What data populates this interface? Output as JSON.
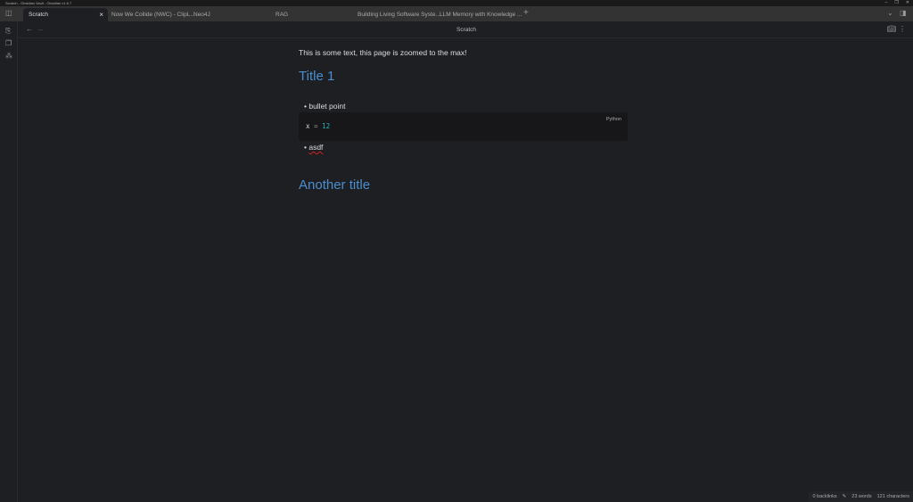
{
  "window": {
    "title": "Scratch - Obsidian Vault - Obsidian v1.6.7"
  },
  "tabs": [
    {
      "label": "Scratch",
      "active": true
    },
    {
      "label": "Now We Collide (NWC) - ClipL..."
    },
    {
      "label": "Neo4J"
    },
    {
      "label": "RAG"
    },
    {
      "label": "Building Living Software Syste..."
    },
    {
      "label": "LLM Memory with Knowledge ..."
    }
  ],
  "header": {
    "title": "Scratch"
  },
  "note": {
    "intro": "This is some text, this page is zoomed to the max!",
    "title1": "Title 1",
    "bullet1": "bullet point",
    "code": {
      "var": "x",
      "op": "=",
      "num": "12",
      "lang": "Python"
    },
    "bullet2": "asdf",
    "title2": "Another title"
  },
  "status": {
    "backlinks": "0 backlinks",
    "words": "23 words",
    "chars": "121 characters"
  },
  "colors": {
    "heading": "#4a8ed0",
    "number": "#2bb3c0",
    "bg": "#1e1f22"
  }
}
